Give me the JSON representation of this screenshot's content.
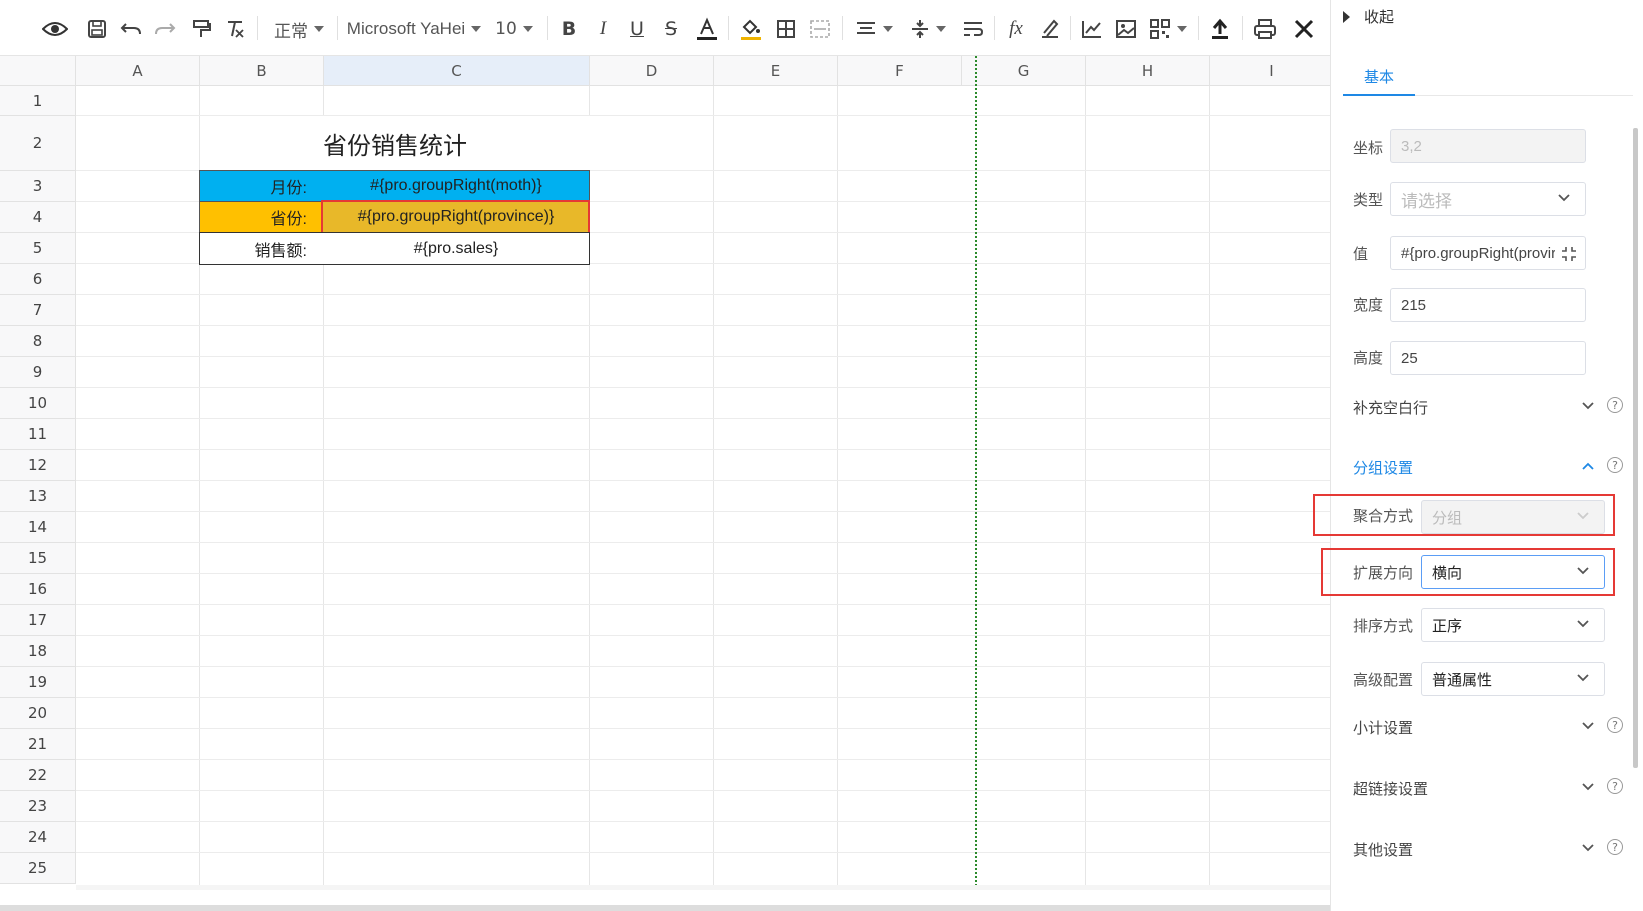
{
  "toolbar": {
    "style_label": "正常",
    "font_name": "Microsoft YaHei",
    "font_size": "10"
  },
  "sheet": {
    "columns": [
      "A",
      "B",
      "C",
      "D",
      "E",
      "F",
      "G",
      "H",
      "I"
    ],
    "rows": [
      "1",
      "2",
      "3",
      "4",
      "5",
      "6",
      "7",
      "8",
      "9",
      "10",
      "11",
      "12",
      "13",
      "14",
      "15",
      "16",
      "17",
      "18",
      "19",
      "20",
      "21",
      "22",
      "23",
      "24",
      "25"
    ],
    "title": "省份销售统计",
    "month_label": "月份:",
    "month_value": "#{pro.groupRight(moth)}",
    "province_label": "省份:",
    "province_value": "#{pro.groupRight(province)}",
    "sales_label": "销售额:",
    "sales_value": "#{pro.sales}",
    "colors": {
      "month_bg": "#00b0f0",
      "province_bg": "#ffc000",
      "selected_bg": "#e8b829",
      "selection_border": "#e53935"
    }
  },
  "panel": {
    "collapse_label": "收起",
    "tab_basic": "基本",
    "coord_label": "坐标",
    "coord_value": "3,2",
    "type_label": "类型",
    "type_placeholder": "请选择",
    "value_label": "值",
    "value_value": "#{pro.groupRight(provir",
    "width_label": "宽度",
    "width_value": "215",
    "height_label": "高度",
    "height_value": "25",
    "fill_blank_label": "补充空白行",
    "group_settings_label": "分组设置",
    "aggregate_label": "聚合方式",
    "aggregate_value": "分组",
    "expand_label": "扩展方向",
    "expand_value": "横向",
    "sort_label": "排序方式",
    "sort_value": "正序",
    "advanced_label": "高级配置",
    "advanced_value": "普通属性",
    "subtotal_label": "小计设置",
    "hyperlink_label": "超链接设置",
    "other_label": "其他设置",
    "help_glyph": "?",
    "accent_color": "#1e88e5"
  }
}
